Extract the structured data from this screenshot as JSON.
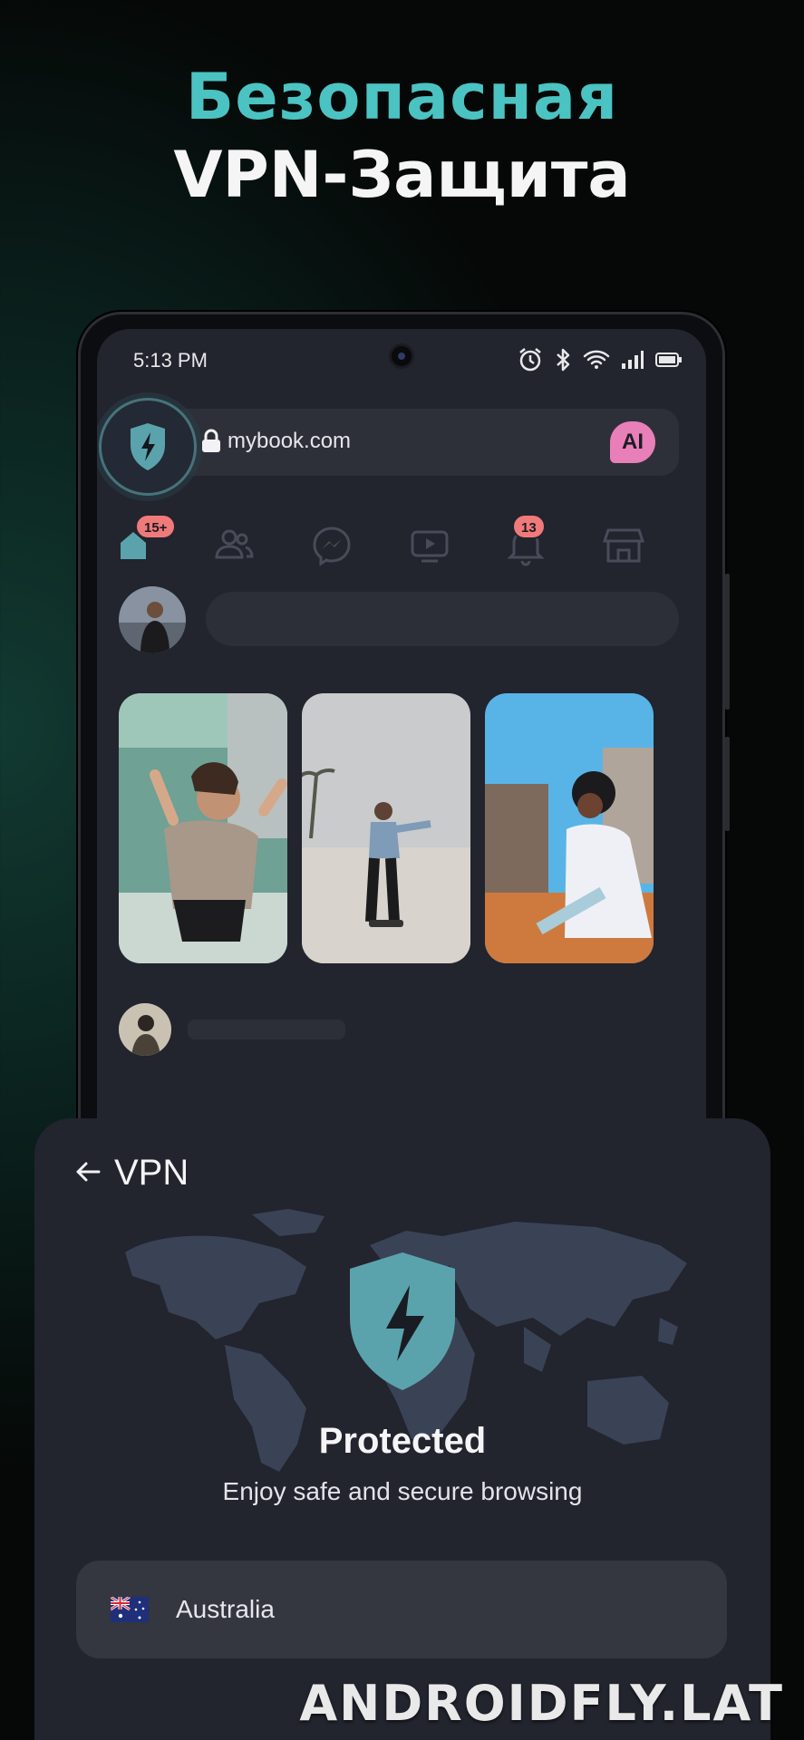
{
  "headline": {
    "line1": "Безопасная",
    "line2": "VPN-Защита"
  },
  "colors": {
    "accent_teal": "#4bc3c2",
    "badge_red": "#f07a7a",
    "ai_pink": "#e97fb8",
    "surface": "#22242e"
  },
  "status_bar": {
    "time": "5:13 PM",
    "icons": [
      "alarm-icon",
      "bluetooth-icon",
      "wifi-icon",
      "signal-icon",
      "battery-icon"
    ]
  },
  "browser": {
    "url": "mybook.com",
    "ai_label": "AI"
  },
  "nav": {
    "items": [
      {
        "name": "home",
        "badge": "15+"
      },
      {
        "name": "friends",
        "badge": ""
      },
      {
        "name": "messenger",
        "badge": ""
      },
      {
        "name": "video",
        "badge": ""
      },
      {
        "name": "notifications",
        "badge": "13"
      },
      {
        "name": "marketplace",
        "badge": ""
      }
    ]
  },
  "vpn": {
    "title": "VPN",
    "status": "Protected",
    "subtitle": "Enjoy safe and secure browsing",
    "country": "Australia",
    "country_flag": "australia-flag-icon"
  },
  "watermark": "ANDROIDFLY.LAT"
}
